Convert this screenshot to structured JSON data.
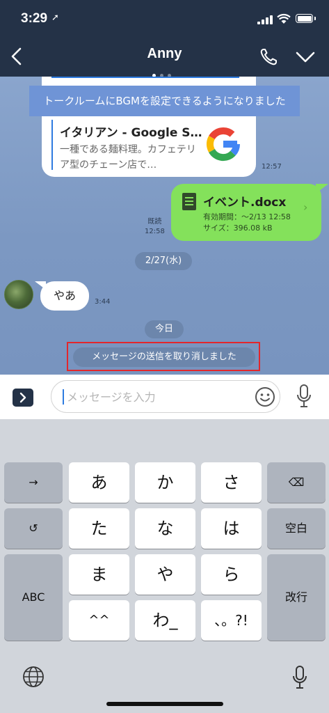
{
  "status_bar": {
    "time": "3:29",
    "location_glyph": "➚"
  },
  "nav": {
    "title": "Anny",
    "back_icon": "chevron-left-icon",
    "call_icon": "phone-icon",
    "menu_icon": "chevron-down-icon"
  },
  "notice": {
    "text": "トークルームにBGMを設定できるようになりました"
  },
  "link_card": {
    "title": "イタリアン - Google S…",
    "desc": "一種である麺料理。カフェテリア型のチェーン店で…",
    "time": "12:57"
  },
  "file_message": {
    "name": "イベント.docx",
    "expiry": "有効期間：〜2/13 12:58",
    "size": "サイズ：396.08 kB",
    "read": "既読",
    "time": "12:58"
  },
  "date_sep": "2/27(水)",
  "incoming": {
    "text": "やあ",
    "time": "3:44"
  },
  "today_sep": "今日",
  "unsent_notice": "メッセージの送信を取り消しました",
  "input": {
    "placeholder": "メッセージを入力"
  },
  "keyboard": {
    "row1": [
      "→",
      "あ",
      "か",
      "さ",
      "⌫"
    ],
    "row2": [
      "↺",
      "た",
      "な",
      "は",
      "空白"
    ],
    "row3": [
      "ABC",
      "ま",
      "や",
      "ら",
      "改行"
    ],
    "row4": [
      "^^",
      "わ_",
      "、。?!"
    ]
  },
  "colors": {
    "header": "#243247",
    "accent_blue": "#2e7be0",
    "bubble_green": "#84e15b",
    "highlight_red": "#e3262b"
  }
}
